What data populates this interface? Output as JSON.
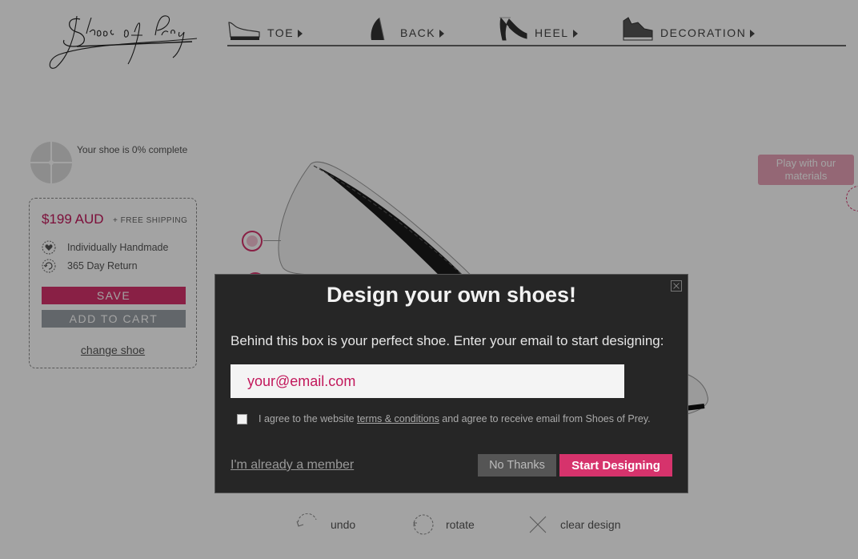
{
  "header": {
    "nav": [
      {
        "label": "TOE",
        "icon": "toe-thumbnail-icon"
      },
      {
        "label": "BACK",
        "icon": "back-thumbnail-icon"
      },
      {
        "label": "HEEL",
        "icon": "heel-thumbnail-icon"
      },
      {
        "label": "DECORATION",
        "icon": "decoration-thumbnail-icon"
      }
    ]
  },
  "sidebar": {
    "progress_text": "Your shoe is 0% complete",
    "progress_percent": 0,
    "price": "$199 AUD",
    "shipping": "+ FREE SHIPPING",
    "features": [
      {
        "label": "Individually Handmade",
        "icon": "heart-icon"
      },
      {
        "label": "365 Day Return",
        "icon": "return-365-icon"
      }
    ],
    "save_label": "SAVE",
    "cart_label": "ADD TO CART",
    "change_label": "change shoe"
  },
  "canvas": {
    "play_label": "Play with our materials"
  },
  "tools": {
    "undo": "undo",
    "rotate": "rotate",
    "clear": "clear design"
  },
  "modal": {
    "title": "Design your own shoes!",
    "subtitle": "Behind this box is your perfect shoe. Enter your email to start designing:",
    "email_placeholder": "your@email.com",
    "agree_pre": "I agree to the website ",
    "agree_link": "terms & conditions",
    "agree_post": " and agree to receive email from Shoes of Prey.",
    "member_link": "I'm already a member",
    "no_thanks": "No Thanks",
    "start": "Start Designing"
  },
  "colors": {
    "accent": "#d6336c",
    "modal_bg": "#262626",
    "overlay": "rgba(0,0,0,0.36)"
  }
}
